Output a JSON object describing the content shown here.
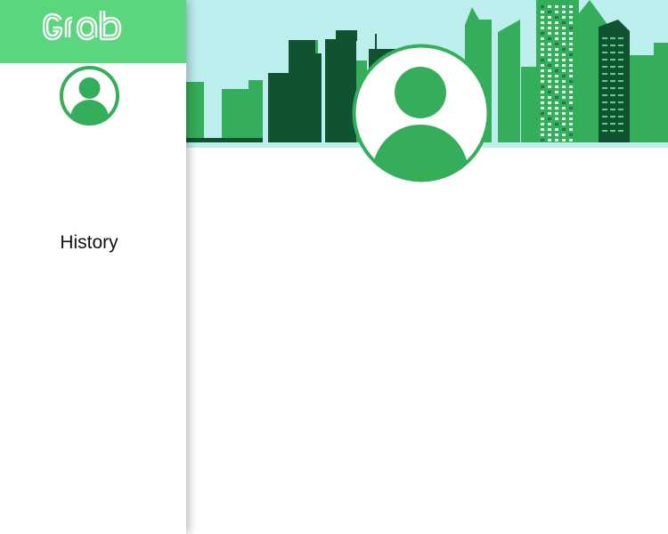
{
  "brand": {
    "logo_text": "Grab",
    "color": "#5ad67c"
  },
  "sidebar": {
    "avatar_icon": "user-avatar-icon",
    "items": [
      {
        "label": "History"
      }
    ]
  },
  "header": {
    "banner": "city-skyline",
    "sky_color": "#bdeeee",
    "building_colors": [
      "#34ae5a",
      "#115231"
    ],
    "avatar_icon": "user-avatar-icon"
  }
}
